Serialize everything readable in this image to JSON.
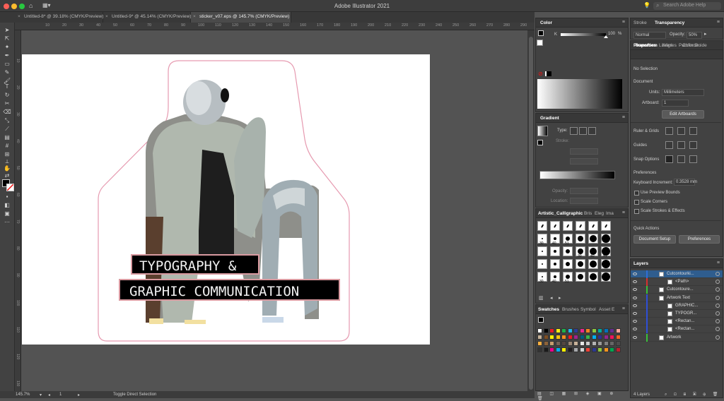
{
  "app": {
    "title": "Adobe Illustrator 2021",
    "help_placeholder": "Search Adobe Help"
  },
  "doc_tabs": [
    {
      "label": "Untitled-8* @ 39.18% (CMYK/Preview)"
    },
    {
      "label": "Untitled-9* @ 45.14% (CMYK/Preview)"
    },
    {
      "label": "sticker_v07.eps @ 145.7% (CMYK/Preview)"
    }
  ],
  "rulers": {
    "h": [
      "10",
      "20",
      "30",
      "40",
      "50",
      "60",
      "70",
      "80",
      "90",
      "100",
      "110",
      "120",
      "130",
      "140",
      "150",
      "160",
      "170",
      "180",
      "190",
      "200",
      "210",
      "220",
      "230",
      "240",
      "250",
      "260",
      "270",
      "280",
      "290",
      "300",
      "310"
    ],
    "v": [
      "10",
      "20",
      "30",
      "40",
      "50",
      "60",
      "70",
      "80",
      "90",
      "100",
      "110",
      "120",
      "130"
    ]
  },
  "artwork": {
    "line1": "TYPOGRAPHY &",
    "line2": "GRAPHIC COMMUNICATION"
  },
  "status": {
    "zoom": "145.7%",
    "artboard_num": "1",
    "tool_hint": "Toggle Direct Selection"
  },
  "color_panel": {
    "title": "Color",
    "k_label": "K",
    "k_value": "100",
    "k_unit": "%"
  },
  "gradient_panel": {
    "title": "Gradient",
    "type_label": "Type:",
    "stroke_label": "Stroke:",
    "opacity_label": "Opacity:",
    "location_label": "Location:"
  },
  "brush_panel": {
    "tabs": [
      "Artistic_Calligraphic",
      "Bris",
      "Eleg",
      "Ima"
    ],
    "sizes": [
      "30",
      "40",
      "51",
      "30",
      "40",
      "51",
      "30",
      "40",
      "51"
    ]
  },
  "swatches_panel": {
    "tabs": [
      "Swatches",
      "Brushes",
      "Symbol",
      "Asset E"
    ],
    "colors": [
      "#ffffff",
      "#000000",
      "#e81e25",
      "#f7ec14",
      "#1bb24b",
      "#23b6ea",
      "#2d3d97",
      "#ec268f",
      "#f58220",
      "#8dc63f",
      "#00a99d",
      "#0072bc",
      "#662d91",
      "#f9a59a",
      "#c6b298",
      "#7d4e24",
      "#fff200",
      "#ffc20e",
      "#f68e1f",
      "#ed1c24",
      "#a3238e",
      "#005b7f",
      "#39b54a",
      "#00aeef",
      "#2e3192",
      "#92278f",
      "#ed145b",
      "#f26522",
      "#fbb040",
      "#8c6239",
      "#c69c6d",
      "#736357",
      "#534741",
      "#998675",
      "#c7b299",
      "#e6e6e6",
      "#cccccc",
      "#b3b3b3",
      "#999999",
      "#808080",
      "#666666",
      "#4d4d4d",
      "#333333",
      "#1a1a1a",
      "#ec008c",
      "#00aeef",
      "#fff200",
      "#231f20",
      "#a7a9ac",
      "#d1d3d4",
      "#ef4136",
      "#2b3990",
      "#8dc63f",
      "#f7941d",
      "#00a651",
      "#be1e2d"
    ]
  },
  "right_panel": {
    "top_tabs": [
      "Stroke",
      "Transparency"
    ],
    "blend_mode": "Normal",
    "opacity_label": "Opacity:",
    "opacity_value": "50%",
    "mid_tabs": [
      "Transform",
      "Align",
      "Pathfinder"
    ],
    "prop_tabs": [
      "Properties",
      "Libraries",
      "Color Guide"
    ],
    "no_selection": "No Selection",
    "document_label": "Document",
    "units_label": "Units:",
    "units_value": "Millimeters",
    "artboard_label": "Artboard:",
    "artboard_value": "1",
    "edit_artboards": "Edit Artboards",
    "rulers_grids": "Ruler & Grids",
    "guides": "Guides",
    "snap_options": "Snap Options",
    "preferences": "Preferences",
    "keyboard_increment_label": "Keyboard Increment:",
    "keyboard_increment_value": "0.3528 mm",
    "use_preview_bounds": "Use Preview Bounds",
    "scale_corners": "Scale Corners",
    "scale_strokes": "Scale Strokes & Effects",
    "quick_actions": "Quick Actions",
    "document_setup": "Document Setup",
    "preferences_btn": "Preferences"
  },
  "layers_panel": {
    "title": "Layers",
    "footer": "4 Layers",
    "rows": [
      {
        "name": "Cutcontourki...",
        "color": "#2f6fd6",
        "indent": 0,
        "selected": true
      },
      {
        "name": "<Path>",
        "color": "#d6302f",
        "indent": 1,
        "selected": false
      },
      {
        "name": "Cutcontoure...",
        "color": "#39c23a",
        "indent": 0,
        "selected": false
      },
      {
        "name": "Artwork Text",
        "color": "#2f4fd6",
        "indent": 0,
        "selected": false
      },
      {
        "name": "GRAPHIC...",
        "color": "#2f4fd6",
        "indent": 1,
        "selected": false
      },
      {
        "name": "TYPOGR...",
        "color": "#2f4fd6",
        "indent": 1,
        "selected": false
      },
      {
        "name": "<Rectan...",
        "color": "#2f4fd6",
        "indent": 1,
        "selected": false
      },
      {
        "name": "<Rectan...",
        "color": "#2f4fd6",
        "indent": 1,
        "selected": false
      },
      {
        "name": "Artwork",
        "color": "#39c23a",
        "indent": 0,
        "selected": false
      }
    ]
  }
}
